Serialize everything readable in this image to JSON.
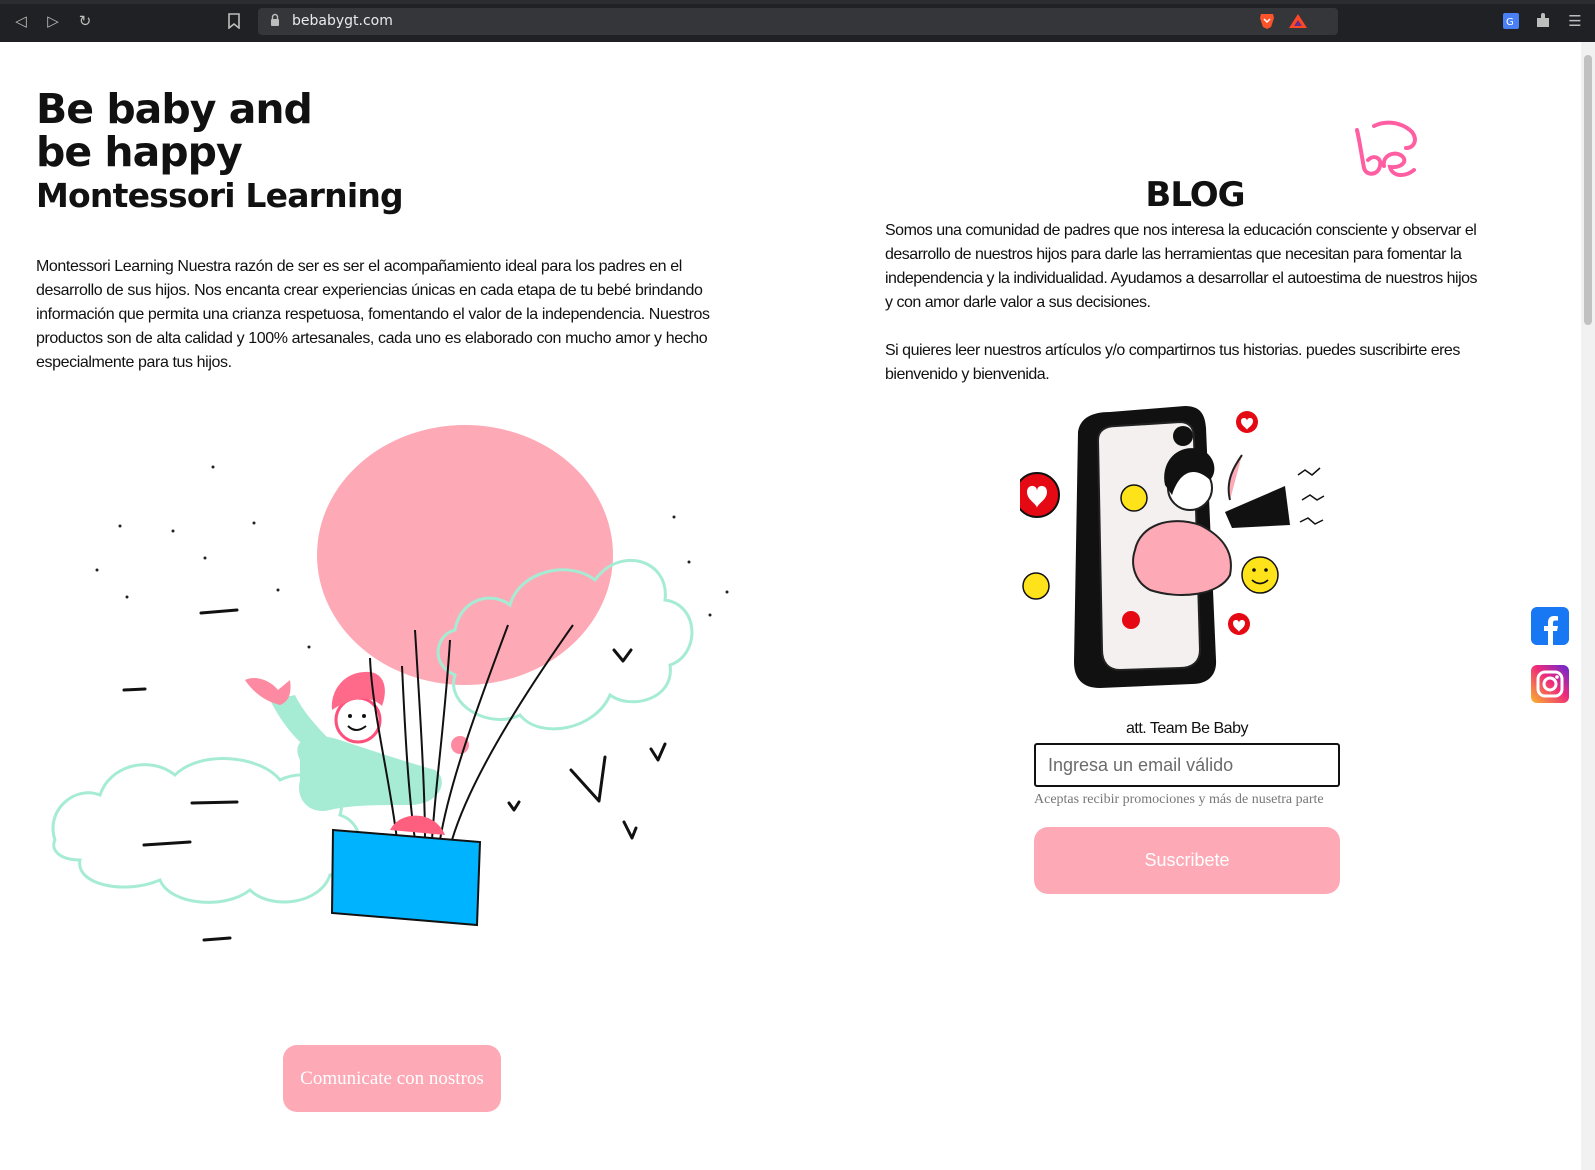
{
  "browser": {
    "url": "bebabygt.com",
    "icons": [
      "back-icon",
      "forward-icon",
      "reload-icon",
      "bookmark-icon",
      "lock-icon",
      "brave-shield-icon",
      "brave-rewards-icon",
      "translate-icon",
      "extensions-icon",
      "menu-icon"
    ]
  },
  "hero": {
    "title_line1": "Be baby and",
    "title_line2": "be happy",
    "subtitle": "Montessori Learning",
    "intro": "Montessori Learning Nuestra razón de ser es ser el acompañamiento ideal para los padres en el desarrollo de sus hijos. Nos encanta crear experiencias únicas en cada etapa de tu bebé brindando información que permita una crianza respetuosa, fomentando el valor de la independencia. Nuestros productos son de alta calidad y 100% artesanales, cada uno es elaborado con mucho amor y hecho especialmente para tus hijos.",
    "contact_button": "Comunicate con nostros"
  },
  "blog": {
    "title": "BLOG",
    "paragraph1": "Somos una comunidad de padres que nos interesa la educación consciente y observar el desarrollo de nuestros hijos para darle las herramientas que necesitan para fomentar la independencia y la individualidad. Ayudamos a desarrollar el autoestima de nuestros hijos y con amor darle valor a sus decisiones.",
    "paragraph2": "Si quieres leer nuestros artículos y/o compartirnos tus historias. puedes suscribirte eres bienvenido y bienvenida.",
    "signature": "att. Team Be Baby",
    "email_placeholder": "Ingresa un email válido",
    "consent": "Aceptas recibir promociones y más de nusetra parte",
    "subscribe_button": "Suscribete"
  },
  "social": {
    "items": [
      "facebook-icon",
      "instagram-icon"
    ]
  },
  "colors": {
    "accent_pink": "#fda9b6",
    "logo_pink": "#ff5fa2",
    "mint": "#a6ecd4",
    "basket_blue": "#00b3ff",
    "chrome_dark": "#202124"
  }
}
